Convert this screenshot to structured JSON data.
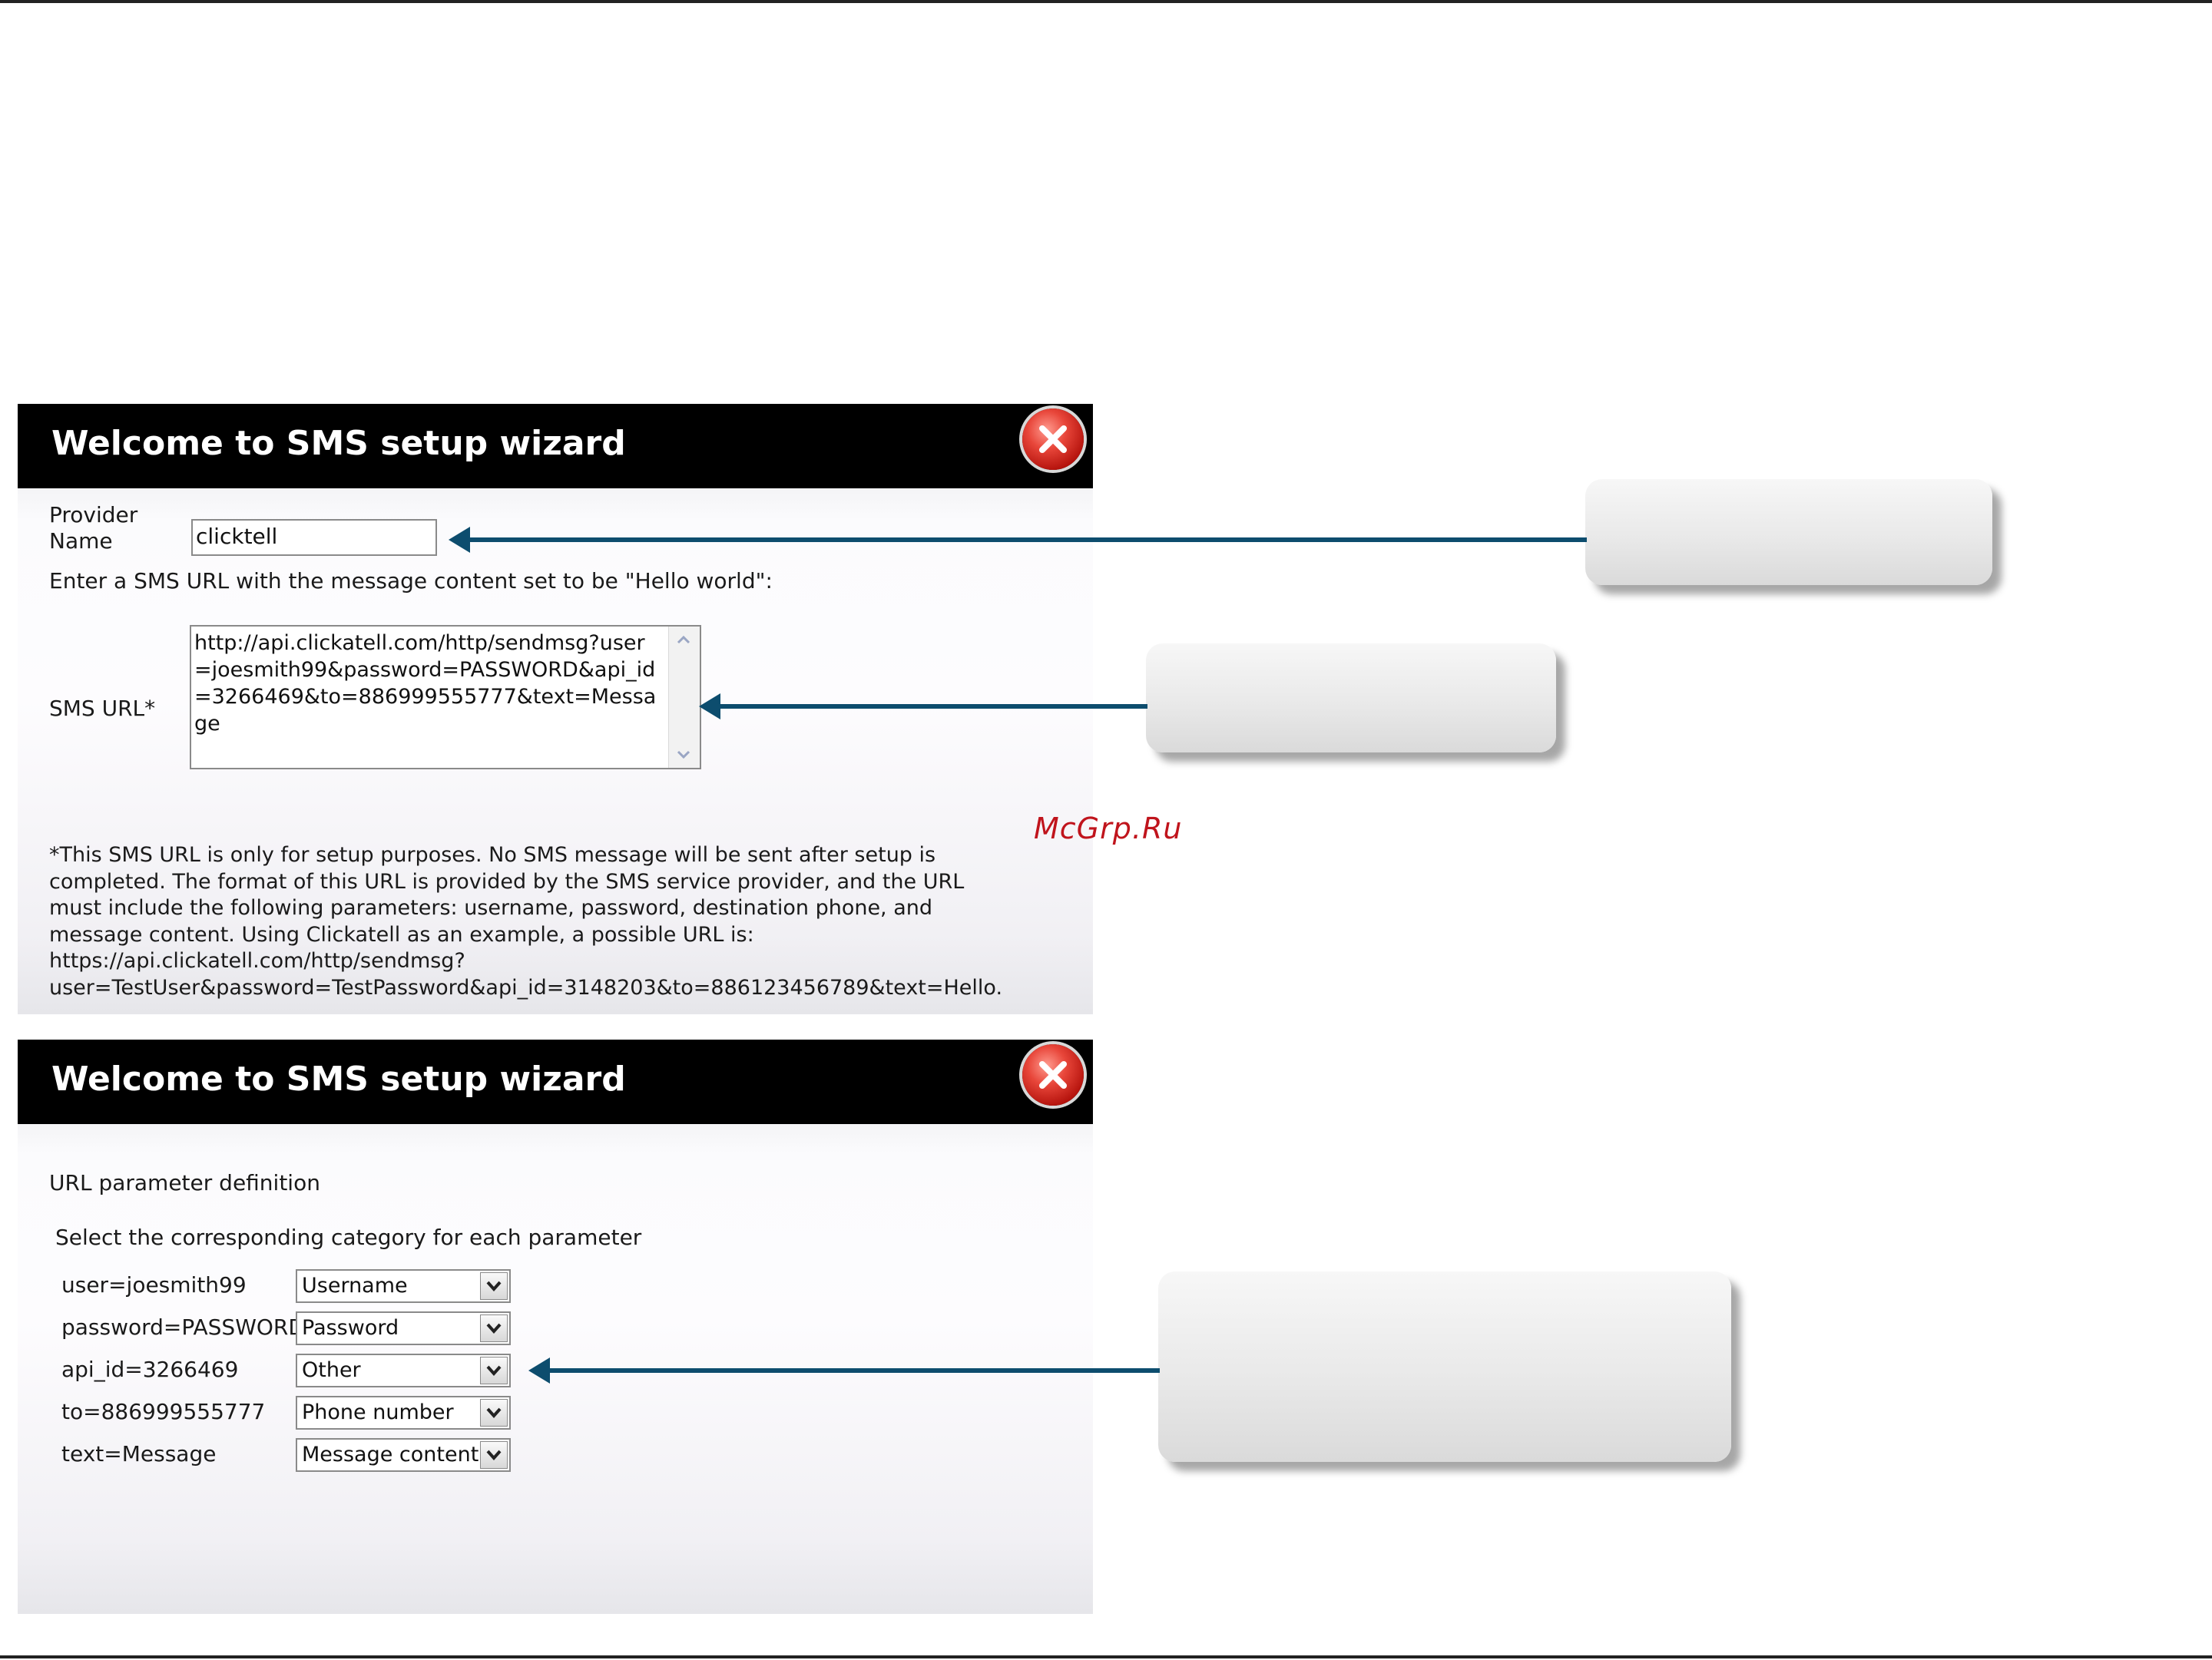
{
  "dialog1": {
    "title": "Welcome to SMS setup wizard",
    "provider_label_line1": "Provider",
    "provider_label_line2": "Name",
    "provider_value": "clicktell",
    "instruction": "Enter a SMS URL with the message content set to be \"Hello world\":",
    "sms_url_label": "SMS URL*",
    "sms_url_value": "http://api.clickatell.com/http/sendmsg?user=joesmith99&password=PASSWORD&api_id=3266469&to=886999555777&text=Message",
    "footnote_lines": [
      "*This SMS URL is only for setup purposes. No SMS message will be sent after setup is",
      "completed. The format of this URL is provided by the SMS service provider, and the URL",
      "must include the following parameters: username, password, destination phone, and",
      "message content. Using Clickatell as an example, a possible URL is:",
      "https://api.clickatell.com/http/sendmsg?",
      "user=TestUser&password=TestPassword&api_id=3148203&to=886123456789&text=Hello."
    ]
  },
  "dialog2": {
    "title": "Welcome to SMS setup wizard",
    "section_title": "URL parameter definition",
    "instruction": "Select the corresponding category for each parameter",
    "params": [
      {
        "param": "user=joesmith99",
        "category": "Username"
      },
      {
        "param": "password=PASSWORD",
        "category": "Password"
      },
      {
        "param": "api_id=3266469",
        "category": "Other"
      },
      {
        "param": "to=886999555777",
        "category": "Phone number"
      },
      {
        "param": "text=Message",
        "category": "Message content"
      }
    ]
  },
  "watermark": "McGrp.Ru",
  "colors": {
    "arrow": "#0d4d6e",
    "title_bar": "#000000",
    "close_button": "#d12a20"
  }
}
